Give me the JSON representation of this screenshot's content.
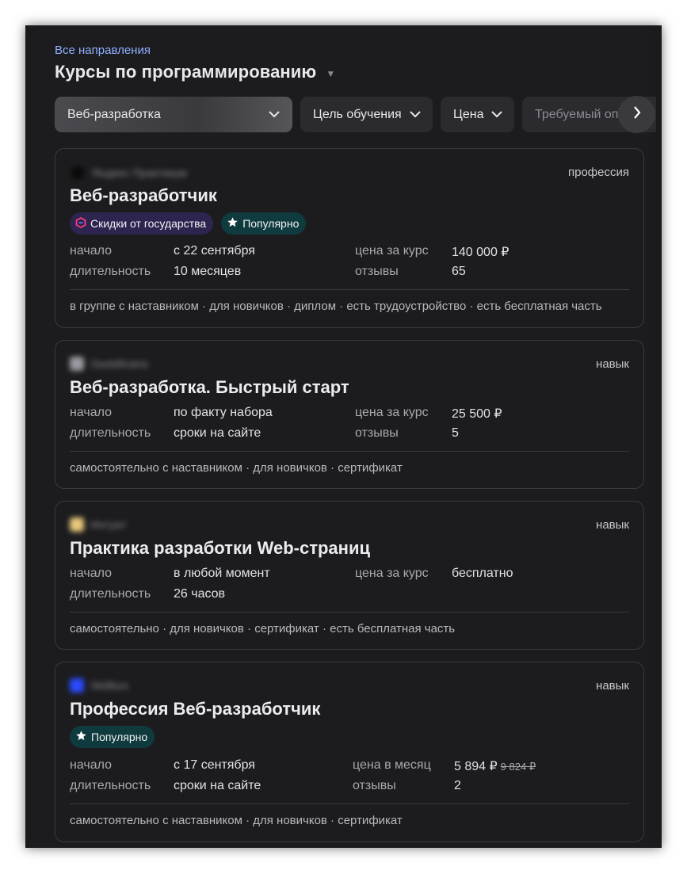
{
  "header": {
    "breadcrumb": "Все направления",
    "title": "Курсы по программированию"
  },
  "filters": [
    {
      "label": "Веб-разработка",
      "active": true
    },
    {
      "label": "Цель обучения",
      "active": false
    },
    {
      "label": "Цена",
      "active": false
    },
    {
      "label": "Требуемый опыт",
      "active": false
    }
  ],
  "courses": [
    {
      "provider": "Яндекс Практикум",
      "kind": "профессия",
      "title": "Веб-разработчик",
      "badges": [
        "Скидки от государства",
        "Популярно"
      ],
      "start_label": "начало",
      "start": "с 22 сентября",
      "duration_label": "длительность",
      "duration": "10 месяцев",
      "price_label": "цена за курс",
      "price": "140 000 ₽",
      "reviews_label": "отзывы",
      "reviews": "65",
      "tags": "в группе с наставником · для новичков · диплом · есть трудоустройство · есть бесплатная часть"
    },
    {
      "provider": "GeekBrains",
      "kind": "навык",
      "title": "Веб-разработка. Быстрый старт",
      "start_label": "начало",
      "start": "по факту набора",
      "duration_label": "длительность",
      "duration": "сроки на сайте",
      "price_label": "цена за курс",
      "price": "25 500 ₽",
      "reviews_label": "отзывы",
      "reviews": "5",
      "tags": "самостоятельно с наставником · для новичков · сертификат"
    },
    {
      "provider": "Интуит",
      "kind": "навык",
      "title": "Практика разработки Web-страниц",
      "start_label": "начало",
      "start": "в любой момент",
      "duration_label": "длительность",
      "duration": "26 часов",
      "price_label": "цена за курс",
      "price": "бесплатно",
      "tags": "самостоятельно · для новичков · сертификат · есть бесплатная часть"
    },
    {
      "provider": "Skillbox",
      "kind": "навык",
      "title": "Профессия Веб-разработчик",
      "badges": [
        "Популярно"
      ],
      "start_label": "начало",
      "start": "с 17 сентября",
      "duration_label": "длительность",
      "duration": "сроки на сайте",
      "price_label": "цена в месяц",
      "price": "5 894 ₽",
      "old_price": "9 824 ₽",
      "reviews_label": "отзывы",
      "reviews": "2",
      "tags": "самостоятельно с наставником · для новичков · сертификат"
    }
  ],
  "colors": {
    "background": "#1c1c1f",
    "link": "#8fb0ff",
    "badge_gov": "#2e2450",
    "badge_popular": "#0f3a3e"
  }
}
